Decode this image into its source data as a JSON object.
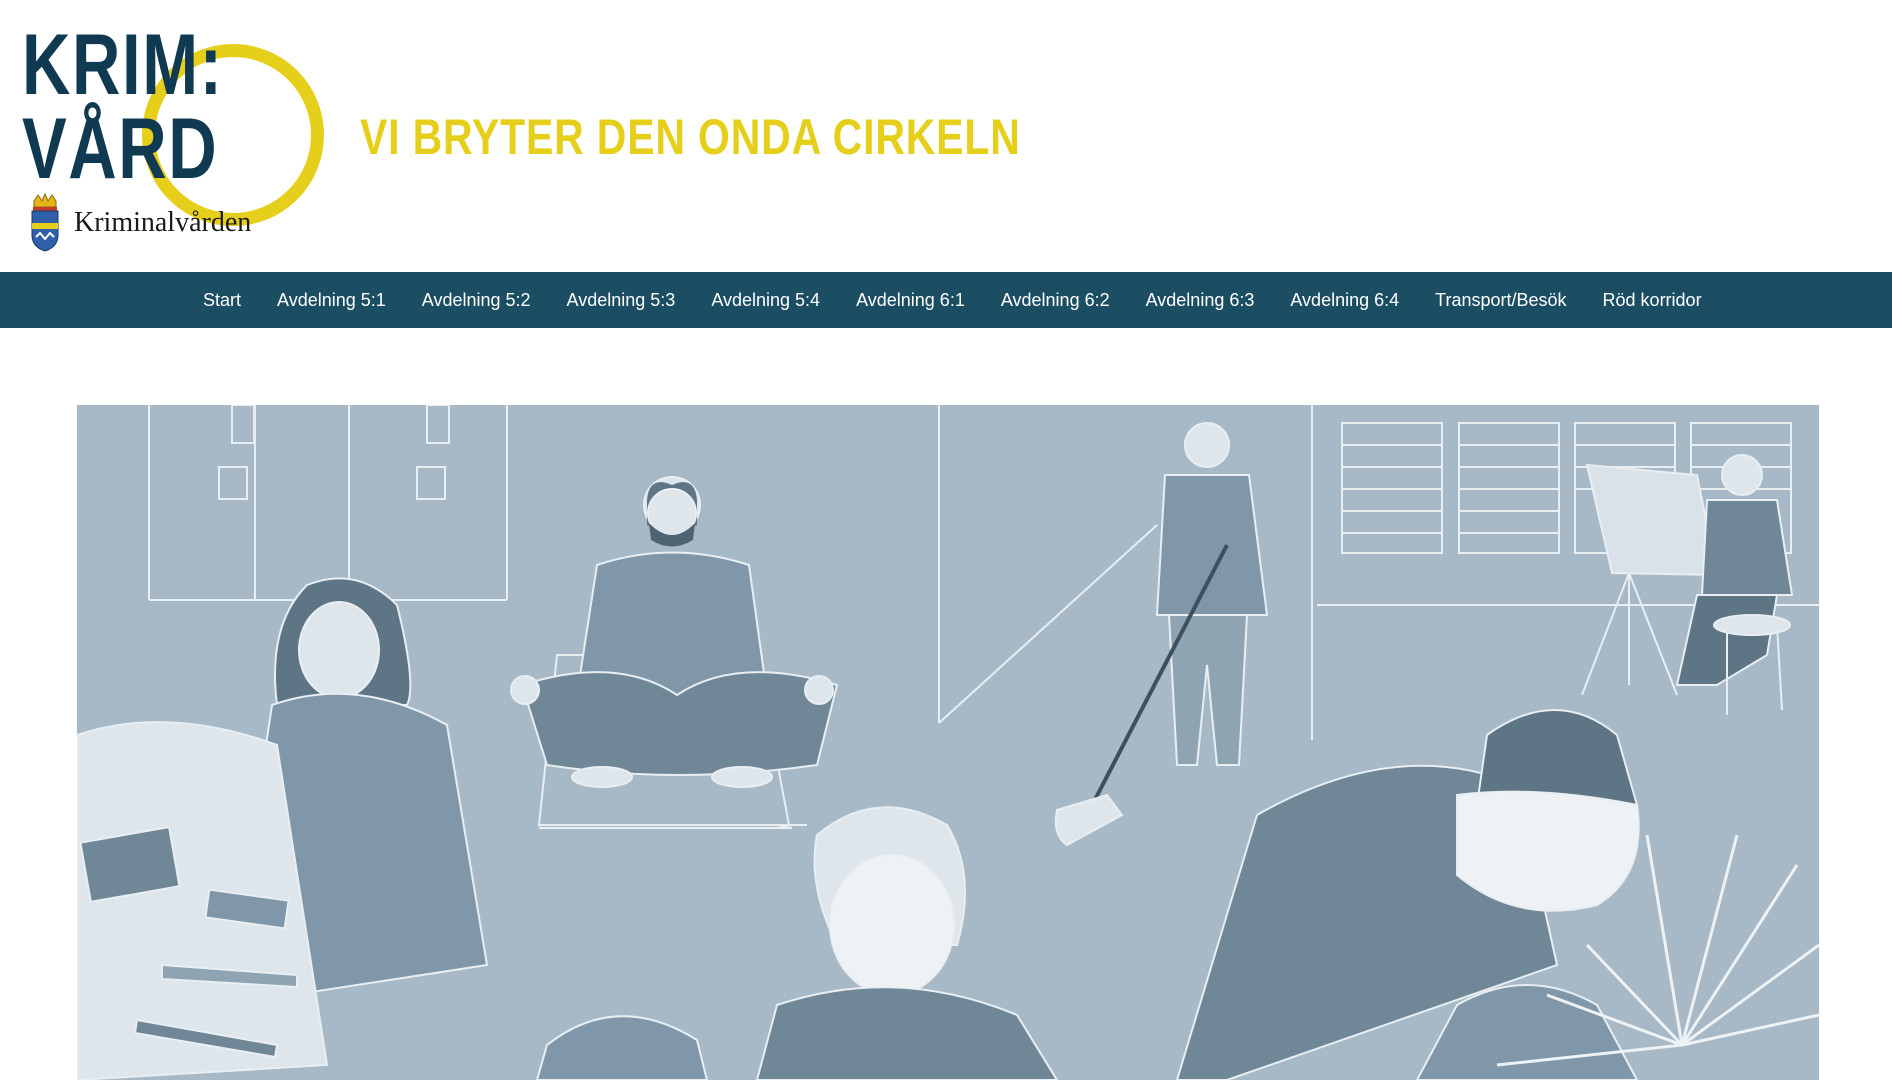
{
  "logo": {
    "line1": "KRIM:",
    "line2": "VÅRD",
    "agency": "Kriminalvården"
  },
  "tagline": "VI BRYTER DEN ONDA CIRKELN",
  "colors": {
    "brand_navy": "#0f3a52",
    "brand_yellow": "#e6cf1a",
    "nav_background": "#1b4d63",
    "hero_background": "#a7b9c6"
  },
  "nav": {
    "items": [
      {
        "label": "Start"
      },
      {
        "label": "Avdelning 5:1"
      },
      {
        "label": "Avdelning 5:2"
      },
      {
        "label": "Avdelning 5:3"
      },
      {
        "label": "Avdelning 5:4"
      },
      {
        "label": "Avdelning 6:1"
      },
      {
        "label": "Avdelning 6:2"
      },
      {
        "label": "Avdelning 6:3"
      },
      {
        "label": "Avdelning 6:4"
      },
      {
        "label": "Transport/Besök"
      },
      {
        "label": "Röd korridor"
      }
    ]
  }
}
